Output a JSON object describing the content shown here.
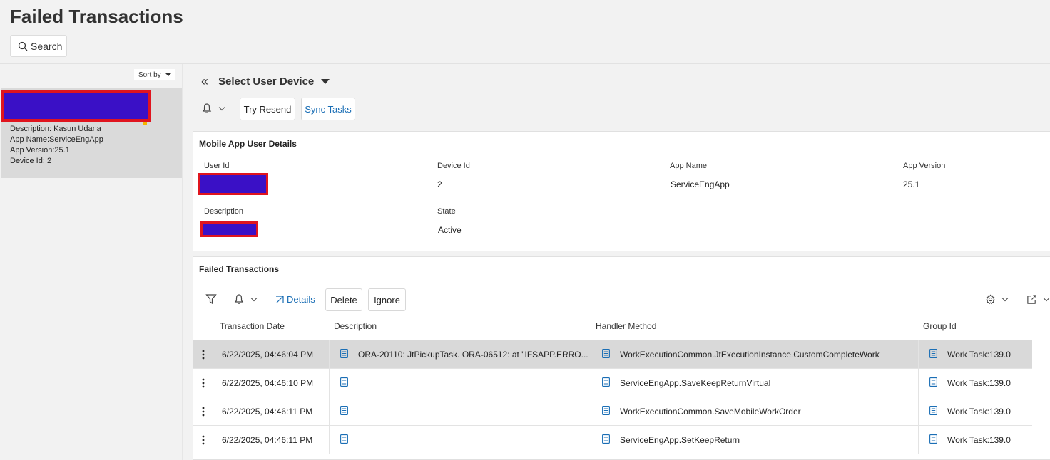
{
  "header": {
    "title": "Failed Transactions",
    "search_label": "Search"
  },
  "list": {
    "sort_label": "Sort by",
    "card": {
      "description_label": "Description:",
      "description_value": "Kasun Udana",
      "app_name_label": "App Name:",
      "app_name_value": "ServiceEngApp",
      "app_version_label": "App Version:",
      "app_version_value": "25.1",
      "device_id_label": "Device Id:",
      "device_id_value": "2"
    }
  },
  "detail": {
    "selector_title": "Select User Device",
    "try_resend": "Try Resend",
    "sync_tasks": "Sync Tasks"
  },
  "user_details": {
    "title": "Mobile App User Details",
    "user_id_label": "User Id",
    "device_id_label": "Device Id",
    "device_id_value": "2",
    "app_name_label": "App Name",
    "app_name_value": "ServiceEngApp",
    "app_version_label": "App Version",
    "app_version_value": "25.1",
    "description_label": "Description",
    "state_label": "State",
    "state_value": "Active"
  },
  "transactions": {
    "title": "Failed Transactions",
    "details": "Details",
    "delete": "Delete",
    "ignore": "Ignore",
    "columns": [
      "Transaction Date",
      "Description",
      "Handler Method",
      "Group Id"
    ],
    "rows": [
      {
        "date": "6/22/2025, 04:46:04 PM",
        "description": "ORA-20110: JtPickupTask. ORA-06512: at \"IFSAPP.ERRO...",
        "handler": "WorkExecutionCommon.JtExecutionInstance.CustomCompleteWork",
        "group": "Work Task:139.0"
      },
      {
        "date": "6/22/2025, 04:46:10 PM",
        "description": "",
        "handler": "ServiceEngApp.SaveKeepReturnVirtual",
        "group": "Work Task:139.0"
      },
      {
        "date": "6/22/2025, 04:46:11 PM",
        "description": "",
        "handler": "WorkExecutionCommon.SaveMobileWorkOrder",
        "group": "Work Task:139.0"
      },
      {
        "date": "6/22/2025, 04:46:11 PM",
        "description": "",
        "handler": "ServiceEngApp.SetKeepReturn",
        "group": "Work Task:139.0"
      }
    ]
  }
}
